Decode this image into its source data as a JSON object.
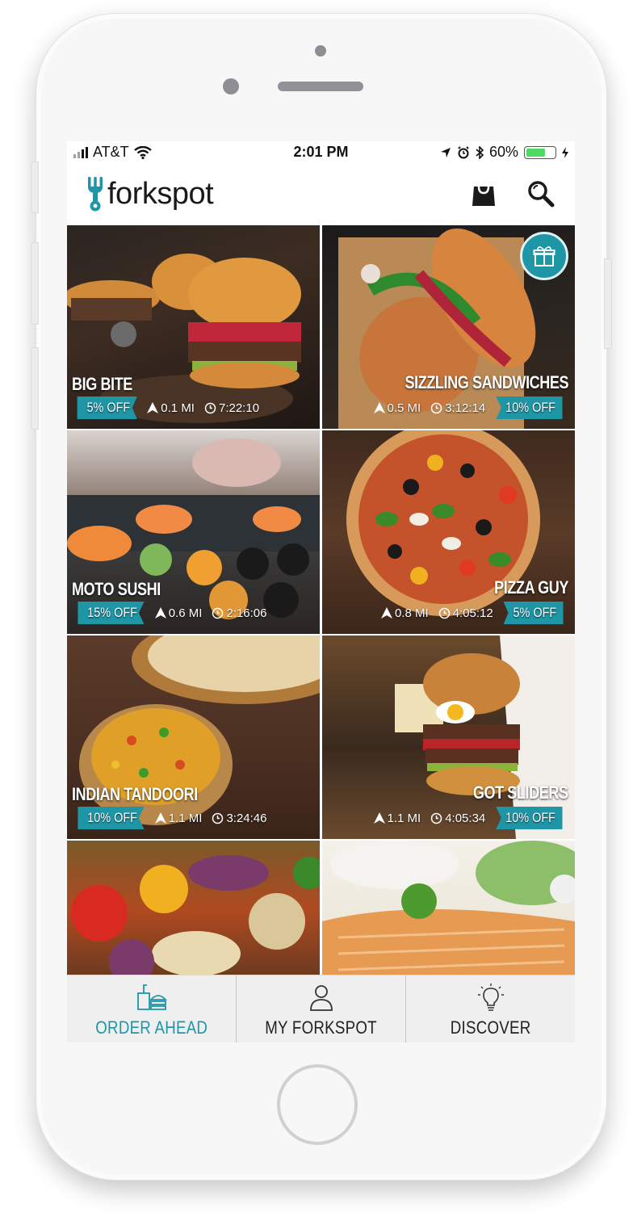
{
  "status_bar": {
    "carrier": "AT&T",
    "time": "2:01 PM",
    "battery_percent": "60%",
    "battery_level": 0.6
  },
  "header": {
    "app_name": "forkspot",
    "brand_color": "#1e96a6",
    "icons": [
      "fork-logo-icon",
      "shopping-bag-icon",
      "search-icon"
    ]
  },
  "restaurants": [
    {
      "name": "BIG BITE",
      "discount": "5% OFF",
      "distance": "0.1 MI",
      "time": "7:22:10",
      "align": "left"
    },
    {
      "name": "SIZZLING SANDWICHES",
      "discount": "10% OFF",
      "distance": "0.5 MI",
      "time": "3:12:14",
      "align": "right",
      "gift": true
    },
    {
      "name": "MOTO SUSHI",
      "discount": "15% OFF",
      "distance": "0.6 MI",
      "time": "2:16:06",
      "align": "left"
    },
    {
      "name": "PIZZA GUY",
      "discount": "5% OFF",
      "distance": "0.8 MI",
      "time": "4:05:12",
      "align": "right"
    },
    {
      "name": "INDIAN TANDOORI",
      "discount": "10% OFF",
      "distance": "1.1 MI",
      "time": "3:24:46",
      "align": "left"
    },
    {
      "name": "GOT SLIDERS",
      "discount": "10% OFF",
      "distance": "1.1 MI",
      "time": "4:05:34",
      "align": "right"
    }
  ],
  "tabs": [
    {
      "label": "ORDER AHEAD",
      "icon": "food-tray-icon",
      "active": true
    },
    {
      "label": "MY FORKSPOT",
      "icon": "person-icon",
      "active": false
    },
    {
      "label": "DISCOVER",
      "icon": "lightbulb-icon",
      "active": false
    }
  ]
}
